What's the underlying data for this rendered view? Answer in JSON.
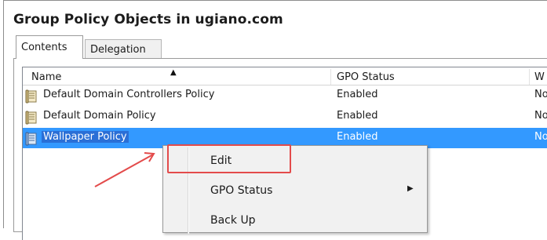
{
  "window": {
    "title": "Group Policy Objects in ugiano.com"
  },
  "tabs": [
    {
      "label": "Contents",
      "active": true
    },
    {
      "label": "Delegation",
      "active": false
    }
  ],
  "list": {
    "columns": [
      "Name",
      "GPO Status",
      "W"
    ],
    "rows": [
      {
        "name": "Default Domain Controllers Policy",
        "status": "Enabled",
        "wmi": "No"
      },
      {
        "name": "Default Domain Policy",
        "status": "Enabled",
        "wmi": "No"
      },
      {
        "name": "Wallpaper Policy",
        "status": "Enabled",
        "wmi": "No",
        "selected": true
      }
    ]
  },
  "context_menu": {
    "items": [
      {
        "label": "Edit",
        "highlighted": true
      },
      {
        "label": "GPO Status",
        "has_submenu": true
      },
      {
        "label": "Back Up"
      }
    ]
  },
  "annotation": {
    "color": "#e34b4b",
    "target": "Edit"
  },
  "colors": {
    "selection": "#3399ff",
    "annotation_red": "#e34b4b"
  }
}
